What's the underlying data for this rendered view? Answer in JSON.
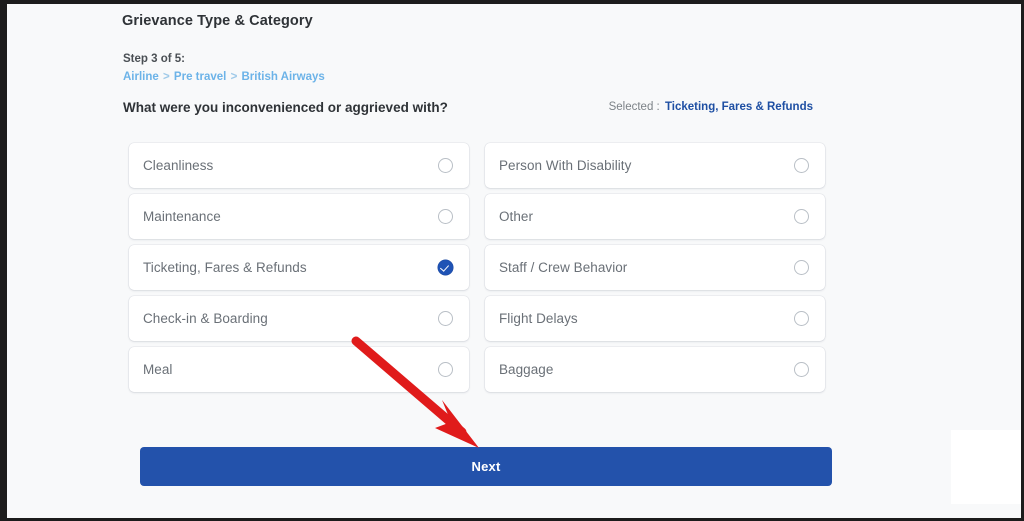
{
  "header": {
    "section_title": "Grievance Type & Category",
    "step_label": "Step 3 of 5:",
    "breadcrumb": {
      "items": [
        "Airline",
        "Pre travel",
        "British Airways"
      ],
      "separator": ">"
    },
    "question": "What were you inconvenienced or aggrieved with?",
    "selected_label": "Selected :",
    "selected_value": "Ticketing, Fares & Refunds"
  },
  "options": [
    {
      "label": "Cleanliness",
      "checked": false
    },
    {
      "label": "Maintenance",
      "checked": false
    },
    {
      "label": "Ticketing, Fares & Refunds",
      "checked": true
    },
    {
      "label": "Check-in & Boarding",
      "checked": false
    },
    {
      "label": "Meal",
      "checked": false
    },
    {
      "label": "Person With Disability",
      "checked": false
    },
    {
      "label": "Other",
      "checked": false
    },
    {
      "label": "Staff / Crew Behavior",
      "checked": false
    },
    {
      "label": "Flight Delays",
      "checked": false
    },
    {
      "label": "Baggage",
      "checked": false
    }
  ],
  "footer": {
    "next_label": "Next"
  },
  "annotation": {
    "arrow_color": "#e01b1b",
    "arrow_target": "next-button"
  },
  "colors": {
    "accent_blue": "#2352ab",
    "breadcrumb_blue": "#6cb3e8",
    "selected_blue": "#1e4fa3",
    "page_background": "#f8f9fa",
    "card_background": "#ffffff",
    "label_grey": "#6a7077"
  }
}
